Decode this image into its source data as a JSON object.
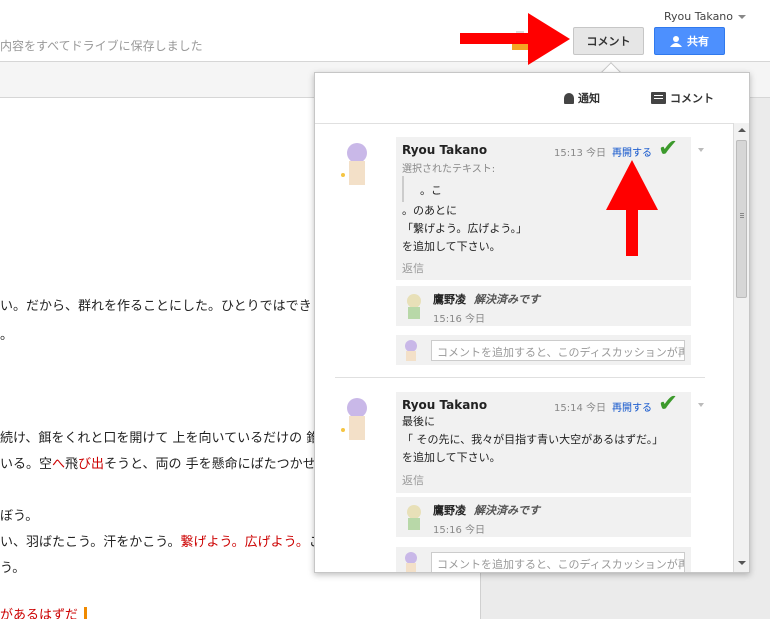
{
  "header": {
    "saved_status": "内容をすべてドライブに保存しました",
    "user_name": "Ryou Takano",
    "comment_button": "コメント",
    "share_button": "共有"
  },
  "document": {
    "lines": [
      {
        "text": "い。だから、群れを作ることにした。ひとりではでき"
      },
      {
        "text": "。"
      },
      {
        "text": "続け、餌をくれと口を開けて 上を向いているだけの 錐"
      },
      {
        "text_pre": "いる。空",
        "text_red1": "へ",
        "text_mid": "飛",
        "text_red2": "び出",
        "text_post": "そうと、両の 手を懸命にばたつかせ"
      },
      {
        "text": "ぼう。"
      },
      {
        "text_pre": "い、羽ばたこう。汗をかこう。",
        "text_red": "繋げよう。広げよう。",
        "text_post": "こ"
      },
      {
        "text": "う。"
      },
      {
        "text": "があるはずだ"
      }
    ]
  },
  "panel": {
    "tab_notify": "通知",
    "tab_comments": "コメント",
    "threads": [
      {
        "author": "Ryou Takano",
        "time": "15:13 今日",
        "reopen": "再開する",
        "selected_label": "選択されたテキスト:",
        "selected_text": "。こ",
        "body": [
          "。のあとに",
          "「繋げよう。広げよう。」",
          "を追加して下さい。"
        ],
        "reply": "返信",
        "resolver": "鷹野凌",
        "resolved_status": "解決済みです",
        "resolved_time": "15:16 今日",
        "add_placeholder": "コメントを追加すると、このディスカッションが再"
      },
      {
        "author": "Ryou Takano",
        "time": "15:14 今日",
        "reopen": "再開する",
        "body": [
          "最後に",
          "「 その先に、我々が目指す青い大空があるはずだ。」",
          "を追加して下さい。"
        ],
        "reply": "返信",
        "resolver": "鷹野凌",
        "resolved_status": "解決済みです",
        "resolved_time": "15:16 今日",
        "add_placeholder": "コメントを追加すると、このディスカッションが再"
      }
    ]
  },
  "colors": {
    "accent": "#4d90fe",
    "annotation_arrow": "#ff0000",
    "resolved_check": "#3c9a2c",
    "link": "#1155cc"
  }
}
